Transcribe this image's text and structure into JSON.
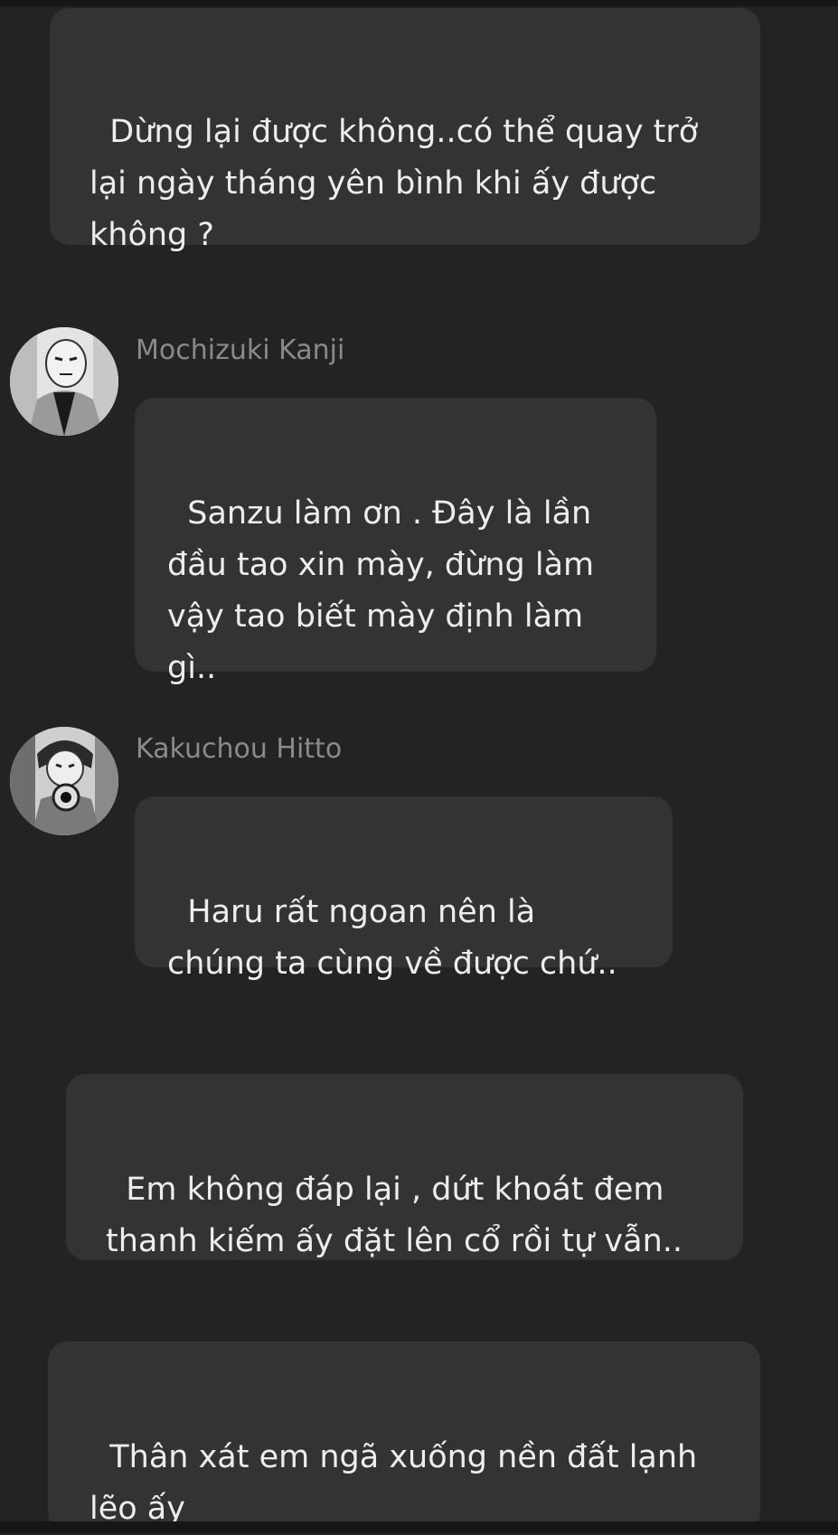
{
  "messages": [
    {
      "type": "narration",
      "text": "Dừng lại được không..có thể quay trở lại ngày tháng yên bình khi ấy được không ?"
    },
    {
      "type": "character",
      "name": "Mochizuki Kanji",
      "avatar_icon": "manga-character-avatar",
      "text": "Sanzu làm ơn . Đây là lần đầu tao xin mày, đừng làm vậy tao biết mày định làm gì.."
    },
    {
      "type": "character",
      "name": "Kakuchou Hitto",
      "avatar_icon": "manga-character-gun-avatar",
      "text": "Haru rất ngoan nên là chúng ta cùng về được chứ.."
    },
    {
      "type": "narration",
      "text": "Em không đáp lại , dứt khoát đem thanh kiếm ấy đặt lên cổ rồi tự vẫn.."
    },
    {
      "type": "narration",
      "text": "Thân xát em ngã xuống nền đất lạnh lẽo ấy"
    }
  ],
  "colors": {
    "background": "#232323",
    "bubble": "#333333",
    "text": "#ededed",
    "name": "#8a8a8a"
  }
}
